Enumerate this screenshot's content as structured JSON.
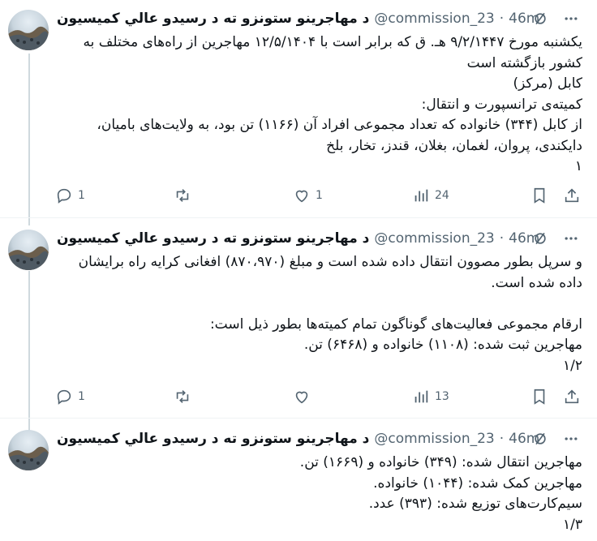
{
  "tweets": [
    {
      "author_name": "د مهاجرينو ستونزو ته د رسيدو عالي کميسيون",
      "handle": "@commission_23",
      "separator": "·",
      "time": "46m",
      "text": "یکشنبه مورخ ۹/۲/۱۴۴۷ هـ. ق که برابر است با ۱۲/۵/۱۴۰۴ مهاجرین از راه‌های مختلف به کشور بازگشته است\nکابل (مرکز)\nکمیته‌ی ترانسپورت و انتقال:\nاز کابل (۳۴۴) خانواده که تعداد مجموعی افراد آن (۱۱۶۶) تن بود، به ولایت‌های بامیان، دایکندی، پروان، لغمان، بغلان، قندز، تخار، بلخ\n۱",
      "replies": "1",
      "retweets": "",
      "likes": "1",
      "views": "24"
    },
    {
      "author_name": "د مهاجرينو ستونزو ته د رسيدو عالي کميسيون",
      "handle": "@commission_23",
      "separator": "·",
      "time": "46m",
      "text": "و سرپل بطور مصوون انتقال داده شده است و مبلغ (۸۷۰،۹۷۰) افغانی کرایه راه برایشان داده شده است.\n\nارقام مجموعی فعالیت‌های گوناگون تمام کمیته‌ها بطور ذیل است:\nمهاجرین ثبت شده: (۱۱۰۸) خانواده و (۶۴۶۸) تن.\n۱/۲",
      "replies": "1",
      "retweets": "",
      "likes": "",
      "views": "13"
    },
    {
      "author_name": "د مهاجرينو ستونزو ته د رسيدو عالي کميسيون",
      "handle": "@commission_23",
      "separator": "·",
      "time": "46m",
      "text": "مهاجرین انتقال شده: (۳۴۹) خانواده و (۱۶۶۹) تن.\nمهاجرین کمک شده: (۱۰۴۴) خانواده.\nسیم‌کارت‌های توزیع شده: (۳۹۳) عدد.\n۱/۳"
    }
  ],
  "icons": {
    "grok": "grok-icon",
    "more": "more-icon",
    "reply": "reply-icon",
    "retweet": "retweet-icon",
    "like": "like-icon",
    "views": "views-icon",
    "bookmark": "bookmark-icon",
    "share": "share-icon"
  },
  "colors": {
    "text": "#0f1419",
    "muted": "#536471",
    "thread_line": "#cfd9de",
    "divider": "#eff3f4"
  }
}
